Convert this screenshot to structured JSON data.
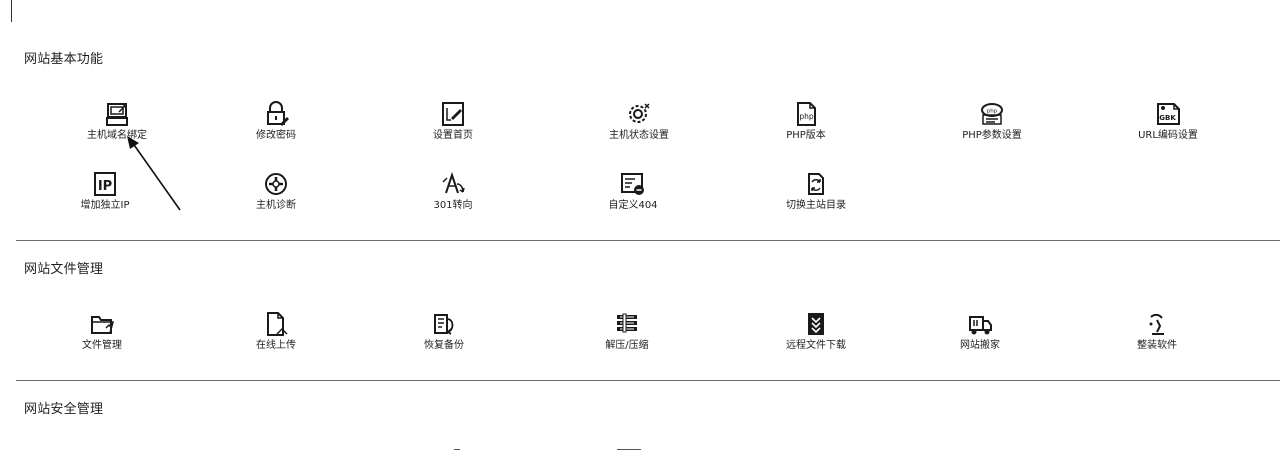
{
  "sections": [
    {
      "title": "网站基本功能",
      "items": [
        {
          "label": "主机域名绑定",
          "icon": "host-domain-bind-icon"
        },
        {
          "label": "修改密码",
          "icon": "password-lock-icon"
        },
        {
          "label": "设置首页",
          "icon": "homepage-settings-icon"
        },
        {
          "label": "主机状态设置",
          "icon": "gear-settings-icon"
        },
        {
          "label": "PHP版本",
          "icon": "php-file-icon"
        },
        {
          "label": "PHP参数设置",
          "icon": "php-parameters-icon"
        },
        {
          "label": "URL编码设置",
          "icon": "gbk-encoding-icon"
        },
        {
          "label": "增加独立IP",
          "icon": "ip-icon"
        },
        {
          "label": "主机诊断",
          "icon": "diagnostics-icon"
        },
        {
          "label": "301转向",
          "icon": "redirect-icon"
        },
        {
          "label": "自定义404",
          "icon": "custom-404-icon"
        },
        {
          "label": "切换主站目录",
          "icon": "switch-directory-icon"
        }
      ]
    },
    {
      "title": "网站文件管理",
      "items": [
        {
          "label": "文件管理",
          "icon": "folder-icon"
        },
        {
          "label": "在线上传",
          "icon": "upload-file-icon"
        },
        {
          "label": "恢复备份",
          "icon": "backup-restore-icon"
        },
        {
          "label": "解压/压缩",
          "icon": "archive-icon"
        },
        {
          "label": "远程文件下载",
          "icon": "remote-download-icon"
        },
        {
          "label": "网站搬家",
          "icon": "moving-truck-icon"
        },
        {
          "label": "整装软件",
          "icon": "software-package-icon"
        }
      ]
    },
    {
      "title": "网站安全管理",
      "items": []
    }
  ]
}
